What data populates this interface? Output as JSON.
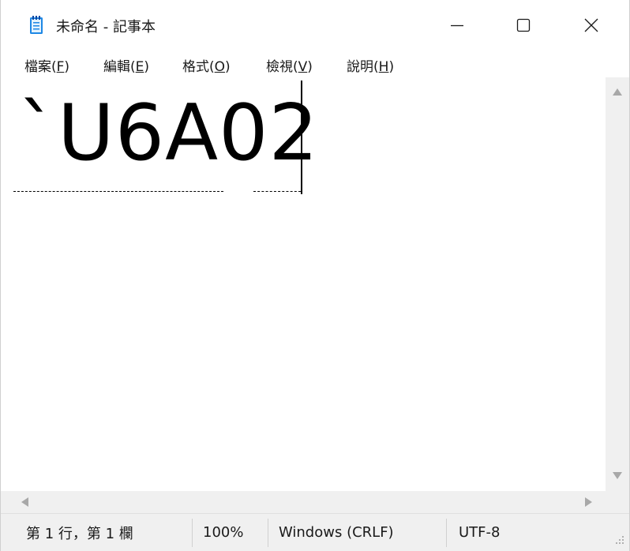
{
  "window": {
    "title": "未命名 - 記事本",
    "icon": "notepad-icon",
    "controls": {
      "minimize": "minimize-icon",
      "maximize": "maximize-icon",
      "close": "close-icon"
    }
  },
  "menu": [
    {
      "label": "檔案(",
      "accel": "F",
      "close": ")"
    },
    {
      "label": "編輯(",
      "accel": "E",
      "close": ")"
    },
    {
      "label": "格式(",
      "accel": "O",
      "close": ")"
    },
    {
      "label": "檢視(",
      "accel": "V",
      "close": ")"
    },
    {
      "label": "說明(",
      "accel": "H",
      "close": ")"
    }
  ],
  "editor": {
    "text": "`U6A02"
  },
  "statusbar": {
    "position": "第 1 行，第 1 欄",
    "zoom": "100%",
    "line_ending": "Windows (CRLF)",
    "encoding": "UTF-8"
  },
  "colors": {
    "background": "#ffffff",
    "chrome": "#f0f0f0",
    "scroll_arrow": "#a8a8a8",
    "icon_blue": "#1e88e5"
  }
}
